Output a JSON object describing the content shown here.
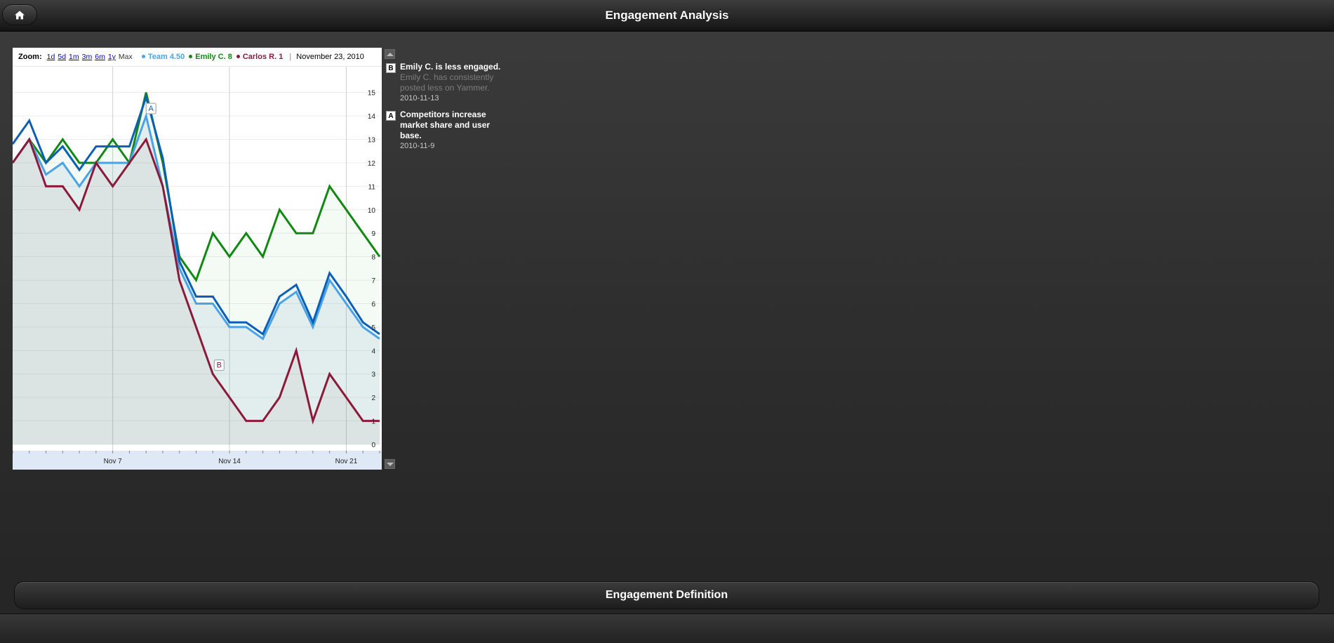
{
  "header": {
    "title": "Engagement Analysis"
  },
  "toolbar": {
    "zoom_label": "Zoom:",
    "zoom_options": [
      "1d",
      "5d",
      "1m",
      "3m",
      "6m",
      "1y",
      "Max"
    ],
    "active_zoom": "Max",
    "current_date": "November 23, 2010"
  },
  "legend": [
    {
      "name": "Team",
      "value": "4.50",
      "color": "#4aa3e8"
    },
    {
      "name": "Emily C.",
      "value": "8",
      "color": "#118811"
    },
    {
      "name": "Carlos R.",
      "value": "1",
      "color": "#8b1a3a"
    }
  ],
  "annotations": [
    {
      "letter": "B",
      "title": "Emily C. is less engaged.",
      "description": "Emily C. has consistently posted less on Yammer.",
      "date": "2010-11-13"
    },
    {
      "letter": "A",
      "title": "Competitors increase market share and user base.",
      "description": "",
      "date": "2010-11-9"
    }
  ],
  "footer_bar": {
    "label": "Engagement Definition"
  },
  "icons": {
    "home": "home-icon",
    "scroll_up": "arrow-up-icon",
    "scroll_down": "arrow-down-icon"
  },
  "chart_data": {
    "type": "line",
    "x": [
      "2010-11-01",
      "2010-11-02",
      "2010-11-03",
      "2010-11-04",
      "2010-11-05",
      "2010-11-06",
      "2010-11-07",
      "2010-11-08",
      "2010-11-09",
      "2010-11-10",
      "2010-11-11",
      "2010-11-12",
      "2010-11-13",
      "2010-11-14",
      "2010-11-15",
      "2010-11-16",
      "2010-11-17",
      "2010-11-18",
      "2010-11-19",
      "2010-11-20",
      "2010-11-21",
      "2010-11-22",
      "2010-11-23"
    ],
    "series": [
      {
        "name": "Team",
        "color": "#4aa3e8",
        "values": [
          12,
          13,
          11.5,
          12,
          11,
          12,
          12,
          12,
          14,
          11,
          7.5,
          6,
          6,
          5,
          5,
          4.5,
          6,
          6.5,
          5,
          7,
          6,
          5,
          4.5
        ]
      },
      {
        "name": "Team",
        "color": "#0b5fb5",
        "values": [
          12.8,
          13.8,
          12,
          12.7,
          11.7,
          12.7,
          12.7,
          12.7,
          14.8,
          12.2,
          7.8,
          6.3,
          6.3,
          5.2,
          5.2,
          4.7,
          6.3,
          6.8,
          5.2,
          7.3,
          6.3,
          5.2,
          4.7
        ]
      },
      {
        "name": "Emily C.",
        "color": "#118811",
        "values": [
          12,
          13,
          12,
          13,
          12,
          12,
          13,
          12,
          15,
          12,
          8,
          7,
          9,
          8,
          9,
          8,
          10,
          9,
          9,
          11,
          10,
          9,
          8
        ]
      },
      {
        "name": "Carlos R.",
        "color": "#8b1a3a",
        "values": [
          12,
          13,
          11,
          11,
          10,
          12,
          11,
          12,
          13,
          11,
          7,
          5,
          3,
          2,
          1,
          1,
          2,
          4,
          1,
          3,
          2,
          1,
          1
        ]
      }
    ],
    "xticks": [
      {
        "x": "2010-11-07",
        "label": "Nov 7"
      },
      {
        "x": "2010-11-14",
        "label": "Nov 14"
      },
      {
        "x": "2010-11-21",
        "label": "Nov 21"
      }
    ],
    "yticks": [
      0,
      1,
      2,
      3,
      4,
      5,
      6,
      7,
      8,
      9,
      10,
      11,
      12,
      13,
      14,
      15
    ],
    "ylim": [
      0,
      15.5
    ],
    "grid": true,
    "markers": [
      {
        "label": "A",
        "x": "2010-11-09",
        "series": "Team"
      },
      {
        "label": "B",
        "x": "2010-11-13",
        "series": "Carlos R."
      }
    ]
  }
}
